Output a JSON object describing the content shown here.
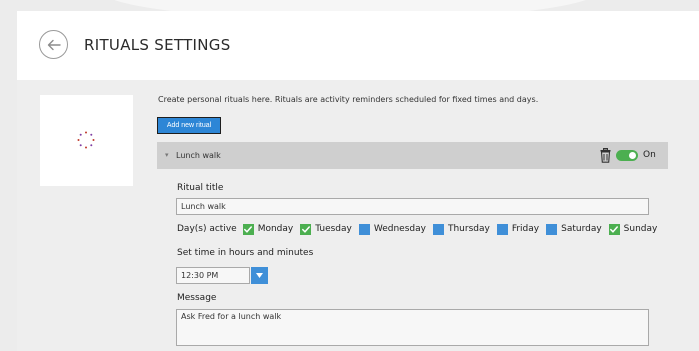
{
  "header": {
    "title": "RITUALS SETTINGS",
    "back_icon": "arrow-left-icon"
  },
  "intro": {
    "text": "Create personal rituals here. Rituals are activity reminders scheduled for fixed times and days.",
    "add_button": "Add new ritual"
  },
  "ritual": {
    "name": "Lunch walk",
    "toggle_label": "On",
    "enabled": true,
    "title_label": "Ritual title",
    "title_value": "Lunch walk",
    "days_label": "Day(s) active",
    "days": [
      {
        "label": "Monday",
        "checked": true
      },
      {
        "label": "Tuesday",
        "checked": true
      },
      {
        "label": "Wednesday",
        "checked": false
      },
      {
        "label": "Thursday",
        "checked": false
      },
      {
        "label": "Friday",
        "checked": false
      },
      {
        "label": "Saturday",
        "checked": false
      },
      {
        "label": "Sunday",
        "checked": true
      }
    ],
    "time_label": "Set time in hours and minutes",
    "time_value": "12:30 PM",
    "message_label": "Message",
    "message_value": "Ask Fred for a lunch walk"
  },
  "colors": {
    "accent": "#2d86d6",
    "checked": "#4caf50",
    "unchecked": "#3f8fd8",
    "ritual_header": "#cfcfcf"
  }
}
